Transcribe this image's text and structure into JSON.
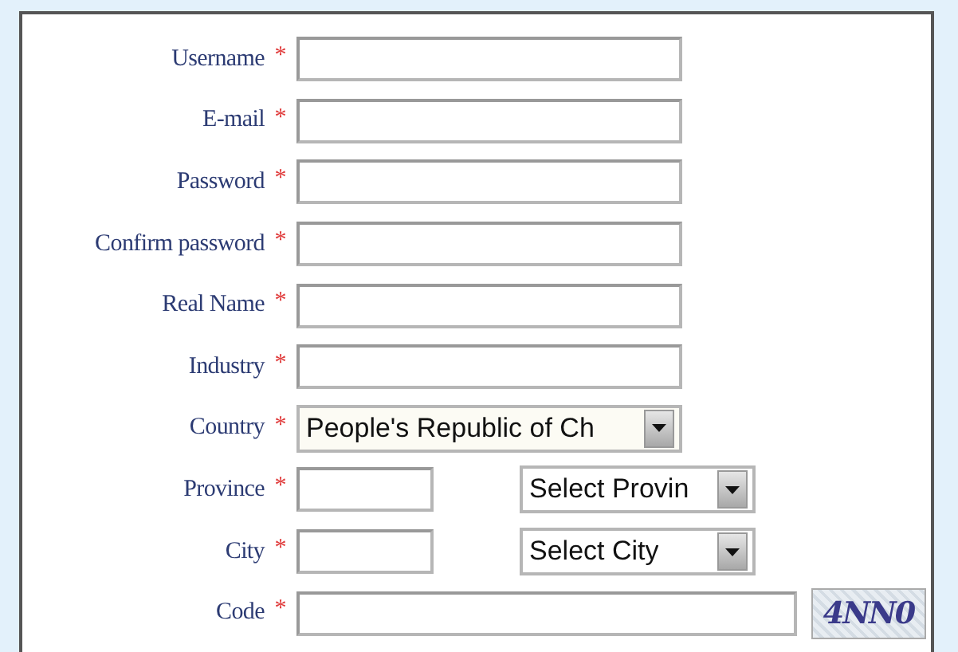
{
  "form": {
    "rows": [
      {
        "kind": "text",
        "label": "Username",
        "mark": "*"
      },
      {
        "kind": "text",
        "label": "E-mail",
        "mark": "*"
      },
      {
        "kind": "text",
        "label": "Password",
        "mark": "*"
      },
      {
        "kind": "text",
        "label": "Confirm password",
        "mark": "*"
      },
      {
        "kind": "text",
        "label": "Real Name",
        "mark": "*"
      },
      {
        "kind": "text",
        "label": "Industry",
        "mark": "*"
      },
      {
        "kind": "select",
        "label": "Country",
        "mark": "*",
        "value": "People's Republic of Ch"
      },
      {
        "kind": "text_select",
        "label": "Province",
        "mark": "*",
        "value": "Select Provin"
      },
      {
        "kind": "text_select",
        "label": "City",
        "mark": "*",
        "value": "Select City"
      },
      {
        "kind": "captcha",
        "label": "Code",
        "mark": "*",
        "captcha": "4NN0"
      }
    ]
  }
}
